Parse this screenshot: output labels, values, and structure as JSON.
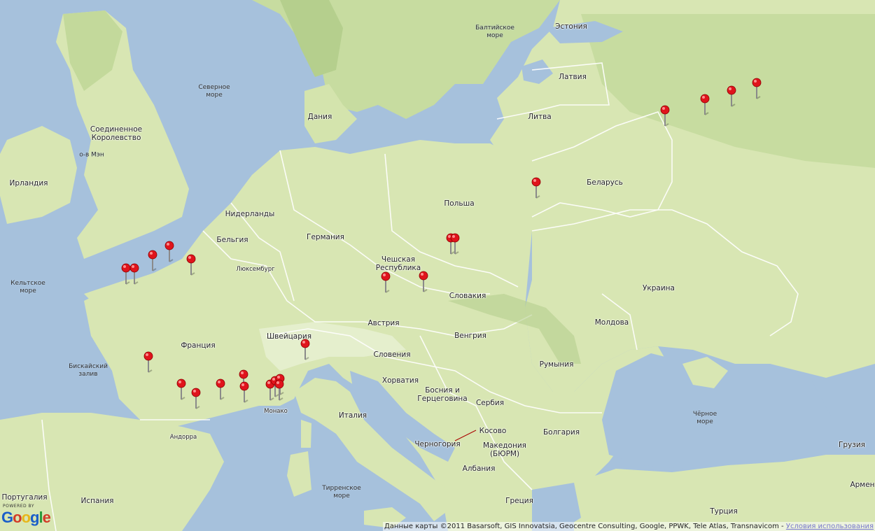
{
  "map": {
    "countries": [
      {
        "key": "estonia",
        "label": "Эстония"
      },
      {
        "key": "latvia",
        "label": "Латвия"
      },
      {
        "key": "lithuania",
        "label": "Литва"
      },
      {
        "key": "belarus",
        "label": "Беларусь"
      },
      {
        "key": "poland",
        "label": "Польша"
      },
      {
        "key": "denmark",
        "label": "Дания"
      },
      {
        "key": "uk",
        "label": "Соединенное\nКоролевство"
      },
      {
        "key": "ireland",
        "label": "Ирландия"
      },
      {
        "key": "netherlands",
        "label": "Нидерланды"
      },
      {
        "key": "germany",
        "label": "Германия"
      },
      {
        "key": "belgium",
        "label": "Бельгия"
      },
      {
        "key": "czech",
        "label": "Чешская\nРеспублика"
      },
      {
        "key": "luxembourg",
        "label": "Люксембург"
      },
      {
        "key": "slovakia",
        "label": "Словакия"
      },
      {
        "key": "ukraine",
        "label": "Украина"
      },
      {
        "key": "austria",
        "label": "Австрия"
      },
      {
        "key": "moldova",
        "label": "Молдова"
      },
      {
        "key": "hungary",
        "label": "Венгрия"
      },
      {
        "key": "switzerland",
        "label": "Швейцария"
      },
      {
        "key": "france",
        "label": "Франция"
      },
      {
        "key": "slovenia",
        "label": "Словения"
      },
      {
        "key": "romania",
        "label": "Румыния"
      },
      {
        "key": "croatia",
        "label": "Хорватия"
      },
      {
        "key": "bosnia",
        "label": "Босния и\nГерцеговина"
      },
      {
        "key": "serbia",
        "label": "Сербия"
      },
      {
        "key": "italy",
        "label": "Италия"
      },
      {
        "key": "kosovo",
        "label": "Косово"
      },
      {
        "key": "bulgaria",
        "label": "Болгария"
      },
      {
        "key": "montenegro",
        "label": "Черногория"
      },
      {
        "key": "macedonia",
        "label": "Македония\n(БЮРМ)"
      },
      {
        "key": "georgia",
        "label": "Грузия"
      },
      {
        "key": "albania",
        "label": "Албания"
      },
      {
        "key": "portugal",
        "label": "Португалия"
      },
      {
        "key": "spain",
        "label": "Испания"
      },
      {
        "key": "greece",
        "label": "Греция"
      },
      {
        "key": "turkey",
        "label": "Турция"
      },
      {
        "key": "armenia",
        "label": "Армен"
      },
      {
        "key": "andorra",
        "label": "Андорра"
      },
      {
        "key": "monaco",
        "label": "Монако"
      }
    ],
    "seas": [
      {
        "key": "baltic",
        "label": "Балтийское\nморе"
      },
      {
        "key": "north",
        "label": "Северное\nморе"
      },
      {
        "key": "isle_of_man",
        "label": "о-в Мэн"
      },
      {
        "key": "celtic",
        "label": "Кельтское\nморе"
      },
      {
        "key": "biscay",
        "label": "Бискайский\nзалив"
      },
      {
        "key": "black",
        "label": "Чёрное\nморе"
      },
      {
        "key": "tyrrhenian",
        "label": "Тирренское\nморе"
      }
    ],
    "marker_icon": "red-map-pin-icon",
    "marker_color": "#e0141c",
    "marker_count": 25
  },
  "branding": {
    "powered_by": "POWERED BY",
    "google_letters": [
      "G",
      "o",
      "o",
      "g",
      "l",
      "e"
    ]
  },
  "footer": {
    "attribution": "Данные карты ©2011 Basarsoft, GIS Innovatsia, Geocentre Consulting, Google, PPWK, Tele Atlas, Transnavicom -",
    "terms_link": "Условия использования"
  },
  "colors": {
    "water": "#a6c1dc",
    "land": "#d8e6b3",
    "forest": "#b6d08f",
    "mountain": "#c9d3a4",
    "border": "#ffffff"
  }
}
